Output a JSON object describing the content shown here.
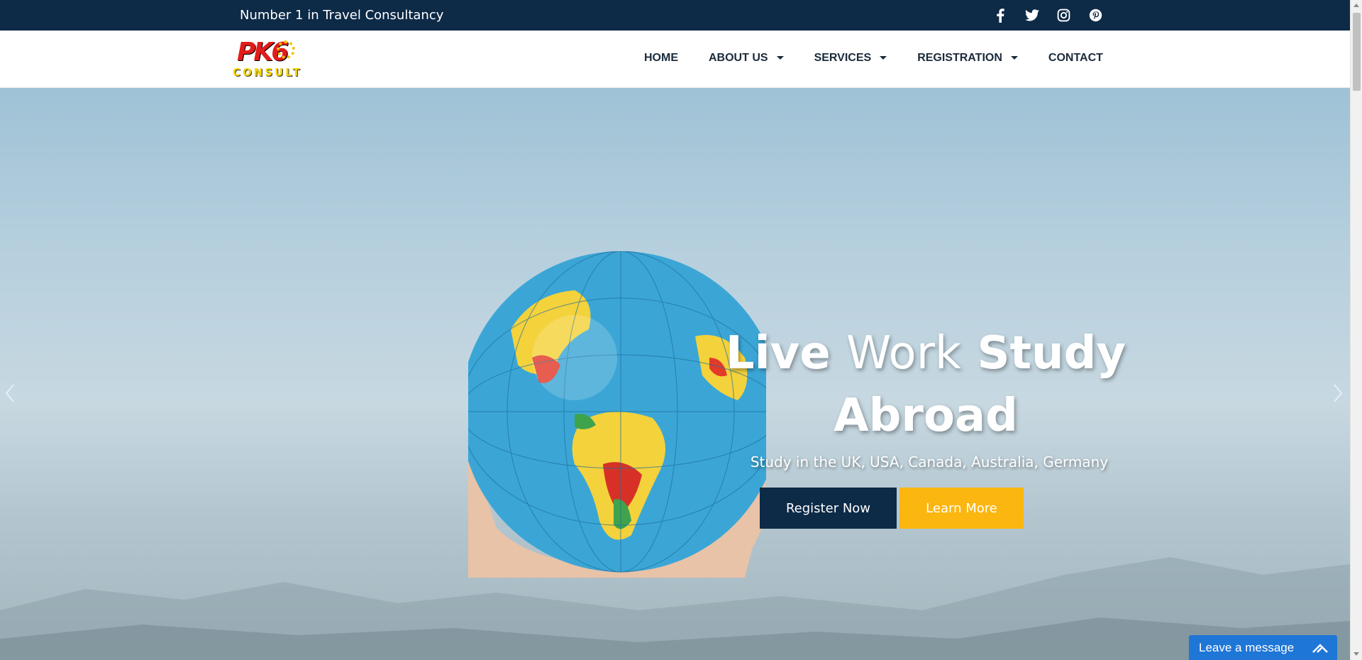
{
  "topbar": {
    "tagline": "Number 1 in Travel Consultancy",
    "social": [
      {
        "icon": "facebook-icon"
      },
      {
        "icon": "twitter-icon"
      },
      {
        "icon": "instagram-icon"
      },
      {
        "icon": "pinterest-icon"
      }
    ]
  },
  "logo": {
    "brand": "PK6",
    "sub": "CONSULT"
  },
  "nav": {
    "items": [
      {
        "label": "HOME",
        "dropdown": false
      },
      {
        "label": "ABOUT US",
        "dropdown": true
      },
      {
        "label": "SERVICES",
        "dropdown": true
      },
      {
        "label": "REGISTRATION",
        "dropdown": true
      },
      {
        "label": "CONTACT",
        "dropdown": false
      }
    ]
  },
  "hero": {
    "headline_word1": "Live",
    "headline_word2": "Work",
    "headline_word3": "Study",
    "headline_word4": "Abroad",
    "subtitle": "Study in the UK, USA, Canada, Australia, Germany",
    "register_label": "Register Now",
    "learn_label": "Learn More"
  },
  "chat": {
    "label": "Leave a message"
  },
  "colors": {
    "navy": "#0d2a47",
    "accent_yellow": "#fbb60f",
    "chat_blue": "#1e76d6"
  }
}
